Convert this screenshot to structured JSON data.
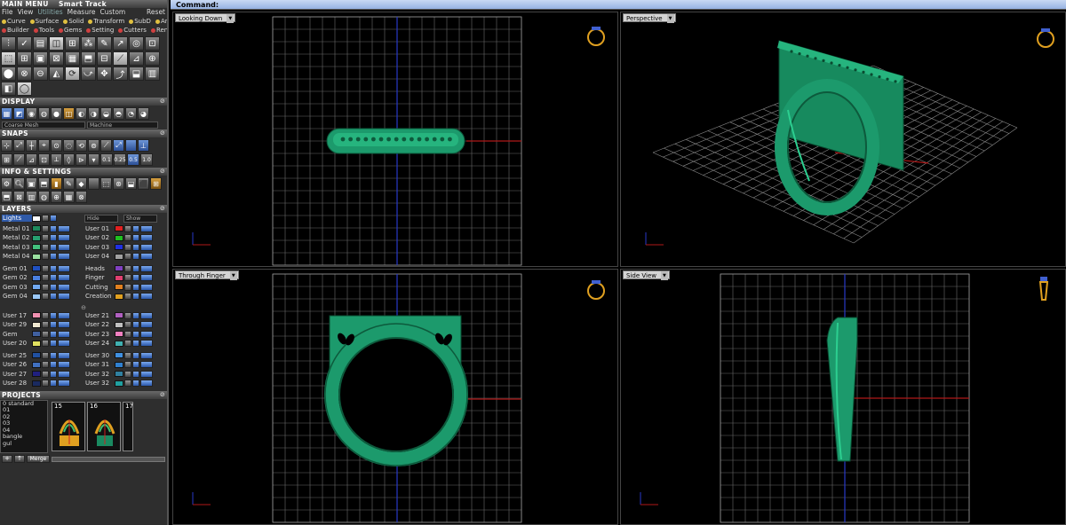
{
  "menu": {
    "title": "MAIN MENU",
    "track": "Smart Track",
    "bar": [
      "File",
      "View",
      "Utilities",
      "Measure",
      "Custom",
      "Reset"
    ],
    "row1": [
      {
        "label": "Curve",
        "color": "#e0c040"
      },
      {
        "label": "Surface",
        "color": "#e0c040"
      },
      {
        "label": "Solid",
        "color": "#e0c040"
      },
      {
        "label": "Transform",
        "color": "#e0c040"
      },
      {
        "label": "SubD",
        "color": "#e0c040"
      },
      {
        "label": "Art",
        "color": "#e0c040"
      }
    ],
    "row2": [
      {
        "label": "Builder",
        "color": "#d04040"
      },
      {
        "label": "Tools",
        "color": "#d04040"
      },
      {
        "label": "Gems",
        "color": "#d04040"
      },
      {
        "label": "Setting",
        "color": "#d04040"
      },
      {
        "label": "Cutters",
        "color": "#d04040"
      },
      {
        "label": "Render",
        "color": "#d04040"
      }
    ]
  },
  "display": {
    "title": "DISPLAY",
    "mode_left": "Coarse Mesh",
    "mode_right": "Machine"
  },
  "snaps": {
    "title": "SNAPS",
    "values": [
      "0.1",
      "0.25",
      "0.5",
      "1.0"
    ]
  },
  "info": {
    "title": "INFO & SETTINGS"
  },
  "layers": {
    "title": "LAYERS",
    "lights": "Lights",
    "hide": "Hide",
    "show": "Show",
    "group1_left": [
      {
        "name": "Metal 01",
        "color": "#1f8a5e"
      },
      {
        "name": "Metal 02",
        "color": "#27a070"
      },
      {
        "name": "Metal 03",
        "color": "#42c07c"
      },
      {
        "name": "Metal 04",
        "color": "#9ae0a0"
      }
    ],
    "group1_right": [
      {
        "name": "User 01",
        "color": "#e02020"
      },
      {
        "name": "User 02",
        "color": "#20c020"
      },
      {
        "name": "User 03",
        "color": "#2030e0"
      },
      {
        "name": "User 04",
        "color": "#a0a0a0"
      }
    ],
    "group2_left": [
      {
        "name": "Gem 01",
        "color": "#2050c0"
      },
      {
        "name": "Gem 02",
        "color": "#4a80e0"
      },
      {
        "name": "Gem 03",
        "color": "#70a8f0"
      },
      {
        "name": "Gem 04",
        "color": "#9ac8f8"
      }
    ],
    "group2_right": [
      {
        "name": "Heads",
        "color": "#8040c0"
      },
      {
        "name": "Finger",
        "color": "#e04070"
      },
      {
        "name": "Cutting",
        "color": "#e08020"
      },
      {
        "name": "Creation",
        "color": "#e0a020"
      }
    ],
    "group3_left": [
      {
        "name": "User 17",
        "color": "#f090b0"
      },
      {
        "name": "User 29",
        "color": "#f0e8d0"
      },
      {
        "name": "Gem",
        "color": "#4060a0"
      },
      {
        "name": "User 20",
        "color": "#e0e060"
      }
    ],
    "group3_right": [
      {
        "name": "User 21",
        "color": "#b060c0"
      },
      {
        "name": "User 22",
        "color": "#c0c0c0"
      },
      {
        "name": "User 23",
        "color": "#f080c0"
      },
      {
        "name": "User 24",
        "color": "#40b0b0"
      }
    ],
    "group4_left": [
      {
        "name": "User 25",
        "color": "#2050a0"
      },
      {
        "name": "User 26",
        "color": "#4070c0"
      },
      {
        "name": "User 27",
        "color": "#202080"
      },
      {
        "name": "User 28",
        "color": "#1a2a60"
      }
    ],
    "group4_right": [
      {
        "name": "User 30",
        "color": "#4090e0"
      },
      {
        "name": "User 31",
        "color": "#3080d0"
      },
      {
        "name": "User 32",
        "color": "#3080a0"
      },
      {
        "name": "User 32",
        "color": "#20a0a0"
      }
    ]
  },
  "projects": {
    "title": "PROJECTS",
    "list": [
      "0 standard",
      "01",
      "02",
      "03",
      "04",
      "bangle",
      "gul"
    ],
    "thumbs": [
      "15",
      "16",
      "17"
    ],
    "merge": "Merge"
  },
  "command": {
    "label": "Command:"
  },
  "viewports": [
    {
      "title": "Looking Down"
    },
    {
      "title": "Perspective"
    },
    {
      "title": "Through Finger"
    },
    {
      "title": "Side View"
    }
  ],
  "colors": {
    "metal": "#1c9a6c",
    "grid": "#6a6a6a",
    "axis_x": "#b01818",
    "axis_y": "#2838c8"
  }
}
